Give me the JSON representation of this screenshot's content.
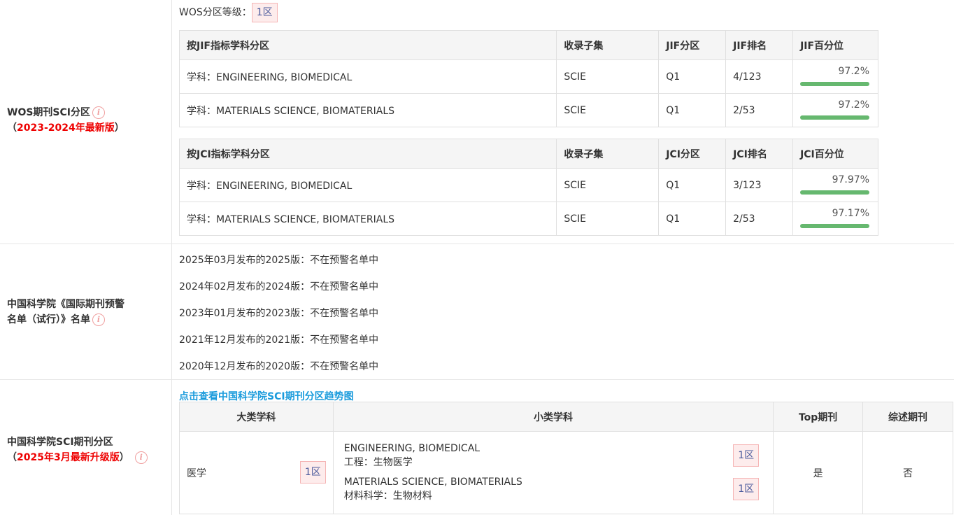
{
  "wos": {
    "label": "WOS期刊SCI分区",
    "label_prefix": "（",
    "edition": "2023-2024年最新版",
    "label_suffix": "）",
    "grade_label": "WOS分区等级：",
    "grade_value": "1区",
    "jif_table": {
      "headers": [
        "按JIF指标学科分区",
        "收录子集",
        "JIF分区",
        "JIF排名",
        "JIF百分位"
      ],
      "rows": [
        {
          "subject": "学科：ENGINEERING, BIOMEDICAL",
          "subset": "SCIE",
          "quartile": "Q1",
          "rank": "4/123",
          "percentile": "97.2%",
          "percentile_value": 97.2
        },
        {
          "subject": "学科：MATERIALS SCIENCE, BIOMATERIALS",
          "subset": "SCIE",
          "quartile": "Q1",
          "rank": "2/53",
          "percentile": "97.2%",
          "percentile_value": 97.2
        }
      ]
    },
    "jci_table": {
      "headers": [
        "按JCI指标学科分区",
        "收录子集",
        "JCI分区",
        "JCI排名",
        "JCI百分位"
      ],
      "rows": [
        {
          "subject": "学科：ENGINEERING, BIOMEDICAL",
          "subset": "SCIE",
          "quartile": "Q1",
          "rank": "3/123",
          "percentile": "97.97%",
          "percentile_value": 97.97
        },
        {
          "subject": "学科：MATERIALS SCIENCE, BIOMATERIALS",
          "subset": "SCIE",
          "quartile": "Q1",
          "rank": "2/53",
          "percentile": "97.17%",
          "percentile_value": 97.17
        }
      ]
    }
  },
  "warning": {
    "label_line1": "中国科学院《国际期刊预警",
    "label_line2": "名单（试行）》名单",
    "items": [
      "2025年03月发布的2025版：不在预警名单中",
      "2024年02月发布的2024版：不在预警名单中",
      "2023年01月发布的2023版：不在预警名单中",
      "2021年12月发布的2021版：不在预警名单中",
      "2020年12月发布的2020版：不在预警名单中"
    ]
  },
  "cas": {
    "label": "中国科学院SCI期刊分区",
    "label_prefix": "（",
    "edition": "2025年3月最新升级版",
    "label_suffix": "）",
    "trend_link": "点击查看中国科学院SCI期刊分区趋势图",
    "headers": [
      "大类学科",
      "小类学科",
      "Top期刊",
      "综述期刊"
    ],
    "major": {
      "name": "医学",
      "zone": "1区"
    },
    "minors": [
      {
        "en": "ENGINEERING, BIOMEDICAL",
        "cn": "工程：生物医学",
        "zone": "1区"
      },
      {
        "en": "MATERIALS SCIENCE, BIOMATERIALS",
        "cn": "材料科学：生物材料",
        "zone": "1区"
      }
    ],
    "top": "是",
    "review": "否"
  },
  "icons": {
    "info": "info-icon"
  },
  "colors": {
    "accent_red": "#ee0000",
    "link_blue": "#1a9bdc",
    "bar_green": "#66b86f",
    "badge_bg": "#fdecec"
  }
}
